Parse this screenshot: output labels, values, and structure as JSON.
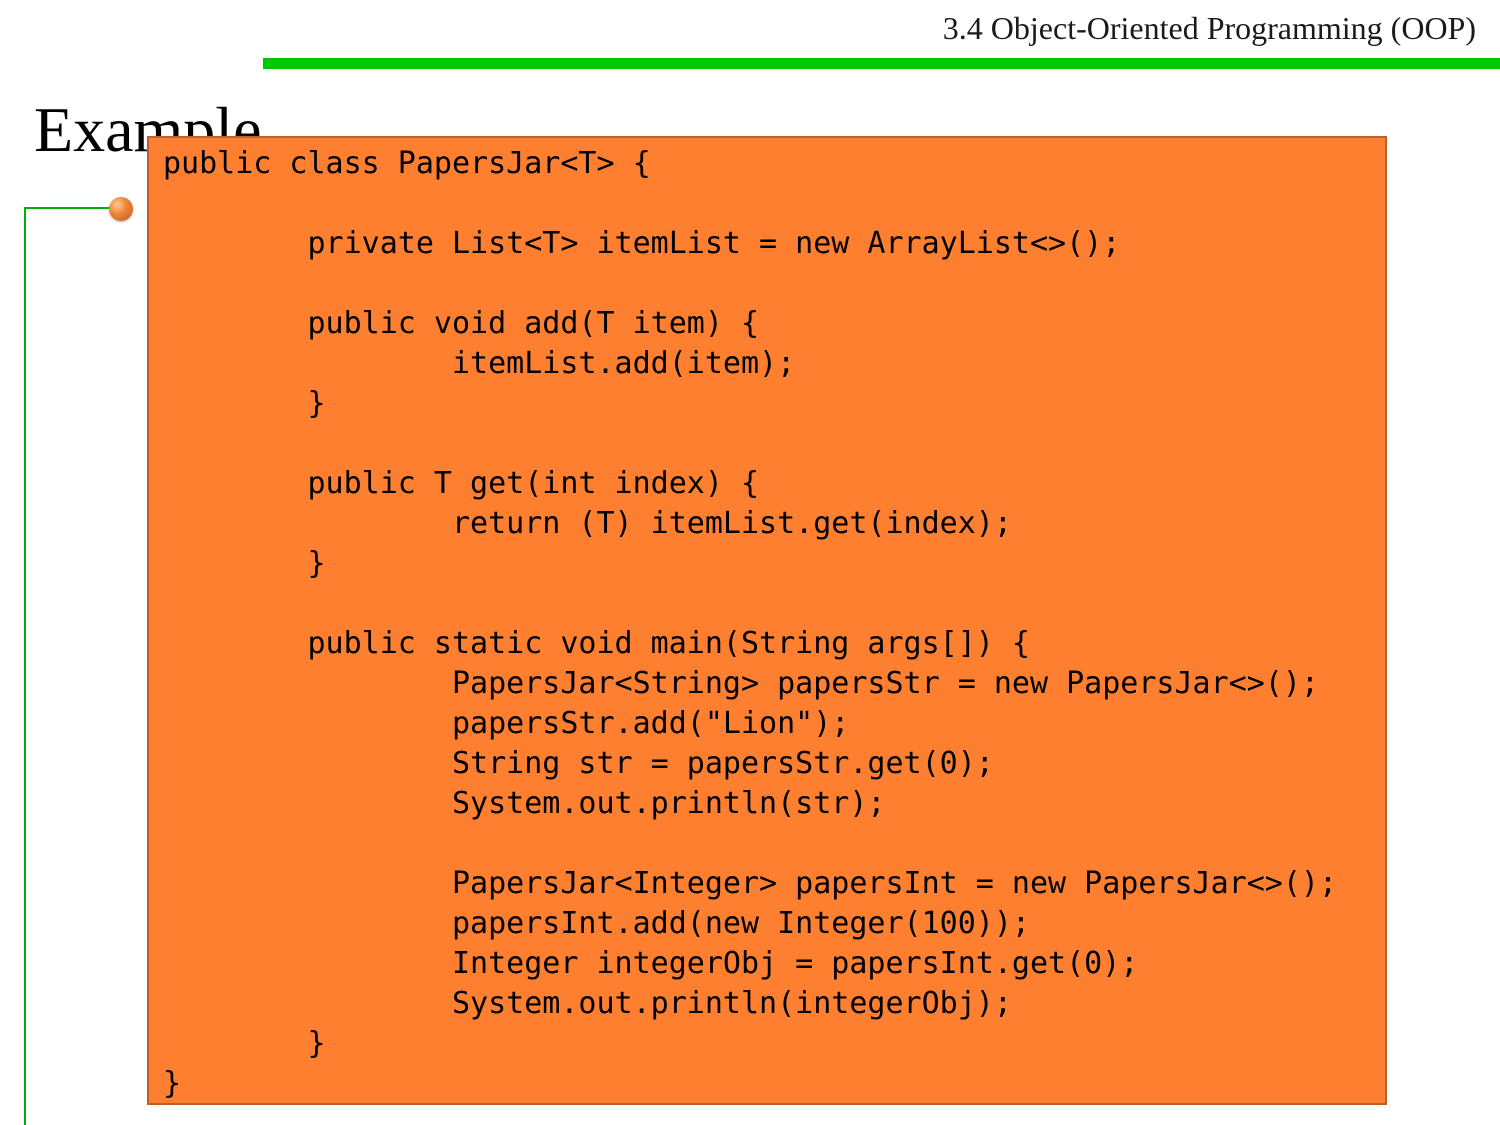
{
  "header": {
    "section_title": "3.4 Object-Oriented Programming (OOP)",
    "accent_color": "#00c800"
  },
  "slide": {
    "title": "Example",
    "bullet_color": "#f08a3c",
    "bracket_color": "#00b000"
  },
  "code_panel": {
    "background_color": "#fd7f2f",
    "lines": [
      "public class PapersJar<T> {",
      "",
      "        private List<T> itemList = new ArrayList<>();",
      "",
      "        public void add(T item) {",
      "                itemList.add(item);",
      "        }",
      "",
      "        public T get(int index) {",
      "                return (T) itemList.get(index);",
      "        }",
      "",
      "        public static void main(String args[]) {",
      "                PapersJar<String> papersStr = new PapersJar<>();",
      "                papersStr.add(\"Lion\");",
      "                String str = papersStr.get(0);",
      "                System.out.println(str);",
      "",
      "                PapersJar<Integer> papersInt = new PapersJar<>();",
      "                papersInt.add(new Integer(100));",
      "                Integer integerObj = papersInt.get(0);",
      "                System.out.println(integerObj);",
      "        }",
      "}"
    ]
  }
}
